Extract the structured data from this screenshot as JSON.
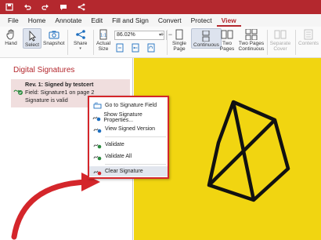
{
  "menu": [
    "File",
    "Home",
    "Annotate",
    "Edit",
    "Fill and Sign",
    "Convert",
    "Protect",
    "View"
  ],
  "ribbon": {
    "hand": "Hand",
    "select": "Select",
    "snapshot": "Snapshot",
    "share": "Share",
    "actual_size": "Actual Size",
    "zoom": "86.02%",
    "zoom_minus": "−",
    "zoom_plus": "+",
    "single_page": "Single Page",
    "continuous": "Continuous",
    "two_pages": "Two Pages",
    "two_pages_continuous": "Two Pages Continuous",
    "separate_cover": "Separate Cover",
    "contents": "Contents"
  },
  "panel": {
    "title": "Digital Signatures",
    "signature": {
      "title": "Rev. 1: Signed by testcert",
      "field": "Field: Signature1 on page 2",
      "status": "Signature is valid"
    }
  },
  "context_menu": [
    {
      "label": "Go to Signature Field",
      "icon": "goto-field-icon"
    },
    {
      "label": "Show Signature Properties...",
      "icon": "signature-properties-icon"
    },
    {
      "label": "View Signed Version",
      "icon": "view-signed-icon"
    },
    {
      "label": "Validate",
      "icon": "validate-icon"
    },
    {
      "label": "Validate All",
      "icon": "validate-all-icon"
    },
    {
      "label": "Clear Signature",
      "icon": "clear-signature-icon",
      "highlighted": true
    }
  ],
  "colors": {
    "accent": "#b4282e",
    "document": "#f1d511",
    "annotation_red": "#d4262b"
  }
}
